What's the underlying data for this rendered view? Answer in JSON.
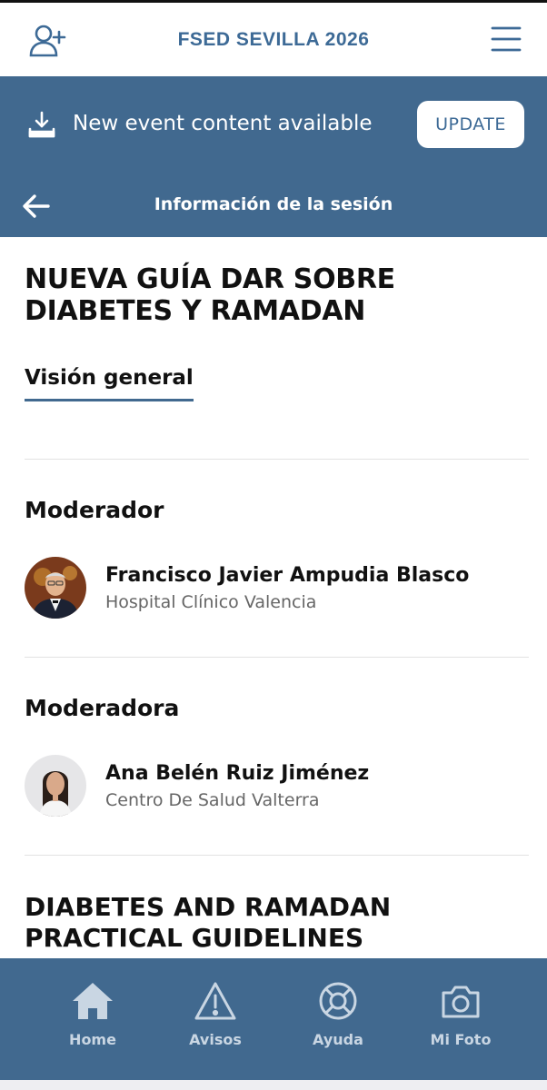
{
  "app": {
    "title": "FSED SEVILLA 2026"
  },
  "banner": {
    "message": "New event content available",
    "update_label": "UPDATE"
  },
  "nav": {
    "title": "Información de la sesión"
  },
  "session": {
    "title": "NUEVA GUÍA DAR SOBRE DIABETES Y RAMADAN",
    "tab": "Visión general"
  },
  "sections": [
    {
      "label": "Moderador",
      "person": {
        "name": "Francisco Javier Ampudia Blasco",
        "org": "Hospital Clínico Valencia"
      }
    },
    {
      "label": "Moderadora",
      "person": {
        "name": "Ana Belén Ruiz Jiménez",
        "org": "Centro De Salud Valterra"
      }
    }
  ],
  "next_title": "DIABETES AND RAMADAN PRACTICAL GUIDELINES",
  "bottom_nav": [
    {
      "label": "Home",
      "icon": "home-icon"
    },
    {
      "label": "Avisos",
      "icon": "warning-icon"
    },
    {
      "label": "Ayuda",
      "icon": "lifebuoy-icon"
    },
    {
      "label": "Mi Foto",
      "icon": "camera-icon"
    }
  ],
  "colors": {
    "brand_blue": "#41698f",
    "title_blue": "#3d6a96",
    "nav_label": "#c9d6e3"
  }
}
